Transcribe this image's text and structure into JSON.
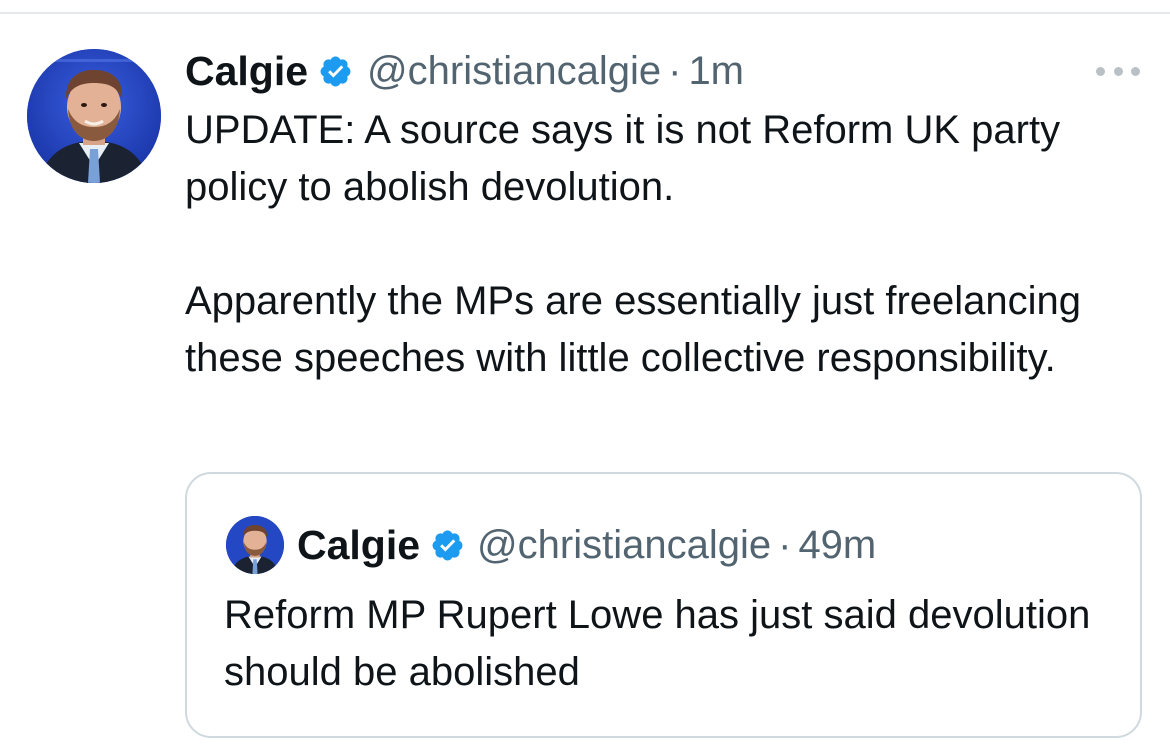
{
  "tweet": {
    "author_name": "Calgie",
    "handle": "@christiancalgie",
    "separator": "·",
    "time": "1m",
    "paragraphs": [
      "UPDATE: A source says it is not Reform UK party policy to abolish devolution.",
      "Apparently the MPs are essentially just freelancing these speeches with little collective responsibility."
    ]
  },
  "quoted_tweet": {
    "author_name": "Calgie",
    "handle": "@christiancalgie",
    "separator": "·",
    "time": "49m",
    "text": "Reform MP Rupert Lowe has just said devolution should be abolished"
  },
  "icons": {
    "verified": "verified-badge-icon",
    "more": "more-options-icon"
  },
  "colors": {
    "text_primary": "#0f1419",
    "text_secondary": "#536471",
    "verified_blue": "#1d9bf0",
    "border": "#cfd9de"
  }
}
